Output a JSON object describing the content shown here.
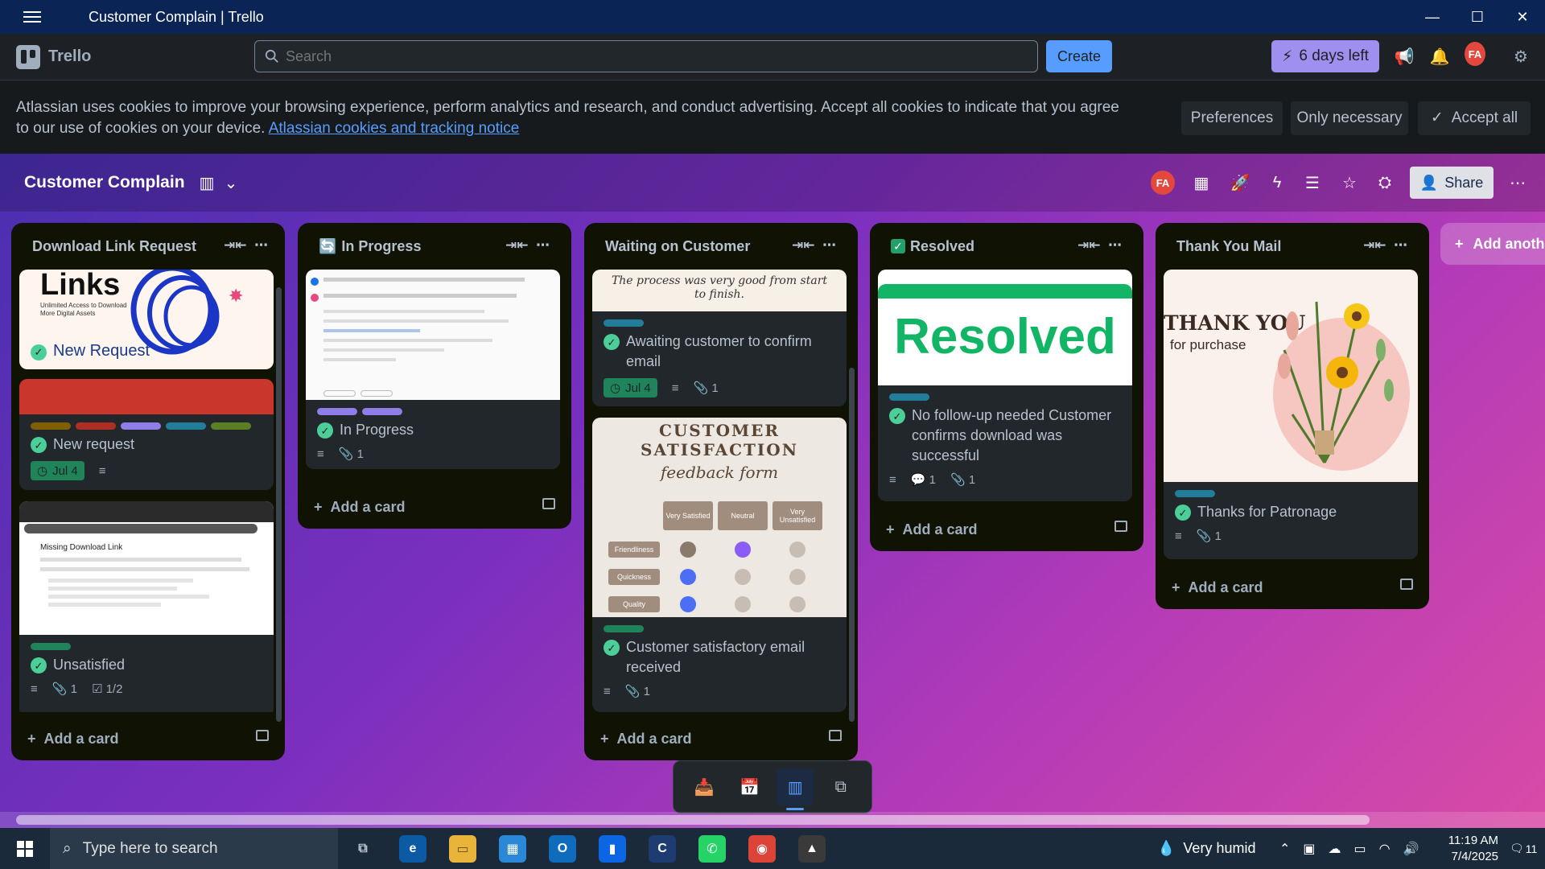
{
  "window": {
    "title": "Customer Complain | Trello",
    "minimize": "—",
    "maximize": "☐",
    "close": "✕"
  },
  "topnav": {
    "logo_text": "Trello",
    "search_placeholder": "Search",
    "create_label": "Create",
    "trial_label": "6 days left",
    "avatar_initials": "FA"
  },
  "cookie": {
    "message": "Atlassian uses cookies to improve your browsing experience, perform analytics and research, and conduct advertising. Accept all cookies to indicate that you agree to our use of cookies on your device.",
    "link": "Atlassian cookies and tracking notice",
    "preferences": "Preferences",
    "only_necessary": "Only necessary",
    "accept_all": "Accept all"
  },
  "board": {
    "title": "Customer Complain",
    "share_label": "Share",
    "avatar_initials": "FA",
    "add_list_label": "Add anoth",
    "add_card_label": "Add a card"
  },
  "lists": [
    {
      "title": "Download Link Request",
      "cards": [
        {
          "cover_text": "Links",
          "cover_sub": "Unlimited Access to Download More Digital Assets",
          "title": "New Request"
        },
        {
          "title": "New request",
          "due": "Jul 4",
          "labels": [
            "#7f5f01",
            "#ae2e24",
            "#8f7ee7",
            "#227d9b",
            "#5b7f24"
          ]
        },
        {
          "cover_heading": "Missing Download Link",
          "title": "Unsatisfied",
          "attachments": "1",
          "checklist": "1/2",
          "labels": [
            "#1f845a"
          ]
        }
      ]
    },
    {
      "title": "In Progress",
      "cards": [
        {
          "title": "In Progress",
          "attachments": "1",
          "labels": [
            "#8f7ee7",
            "#8f7ee7"
          ]
        }
      ]
    },
    {
      "title": "Waiting on Customer",
      "cards": [
        {
          "cover_text": "The process was very good from start to finish.",
          "title": "Awaiting customer to confirm email",
          "due": "Jul 4",
          "attachments": "1",
          "labels": [
            "#227d9b"
          ]
        },
        {
          "cover_title_1": "CUSTOMER",
          "cover_title_2": "SATISFACTION",
          "cover_script": "feedback form",
          "cover_cols": [
            "Very Satisfied",
            "Neutral",
            "Very Unsatisfied"
          ],
          "cover_rows": [
            "Friendliness",
            "Quickness",
            "Quality"
          ],
          "title": "Customer satisfactory email received",
          "attachments": "1",
          "labels": [
            "#1f845a"
          ]
        }
      ]
    },
    {
      "title": "Resolved",
      "cards": [
        {
          "cover_text": "Resolved",
          "title": "No follow-up needed Customer confirms download was successful",
          "comments": "1",
          "attachments": "1",
          "labels": [
            "#227d9b"
          ]
        }
      ]
    },
    {
      "title": "Thank You Mail",
      "cards": [
        {
          "cover_text": "THANK YOU",
          "cover_sub": "for purchase",
          "title": "Thanks for Patronage",
          "attachments": "1",
          "labels": [
            "#227d9b"
          ]
        }
      ]
    }
  ],
  "taskbar": {
    "search_placeholder": "Type here to search",
    "weather": "Very humid",
    "time": "11:19 AM",
    "date": "7/4/2025",
    "notif_count": "11"
  }
}
